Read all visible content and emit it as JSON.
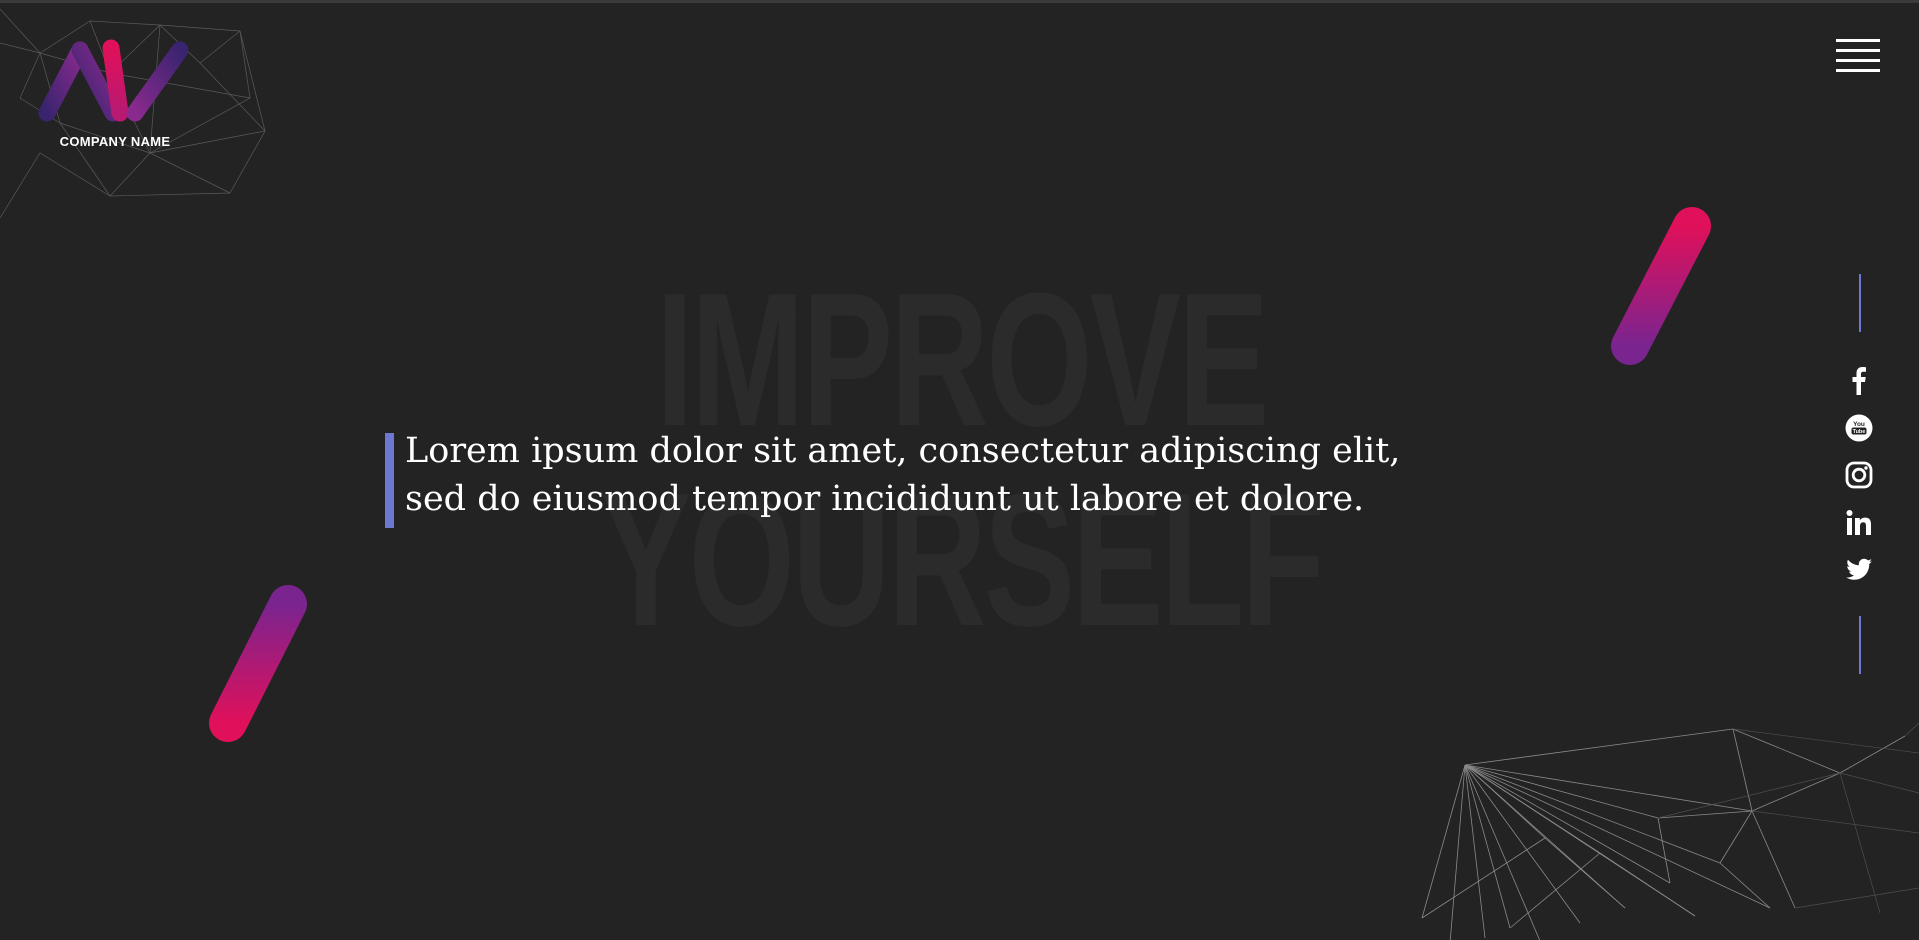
{
  "header": {
    "company_name": "COMPANY NAME",
    "logo_icon": "zigzag-logo-icon",
    "menu_icon": "hamburger-menu-icon"
  },
  "hero": {
    "background_word_line1": "IMPROVE",
    "background_word_line2": "YOURSELF",
    "quote": "Lorem ipsum dolor sit amet, consectetur adipiscing elit, sed do eiusmod tempor incididunt ut labore et dolore."
  },
  "social": {
    "items": [
      {
        "icon": "facebook-icon"
      },
      {
        "icon": "youtube-icon"
      },
      {
        "icon": "instagram-icon"
      },
      {
        "icon": "linkedin-icon"
      },
      {
        "icon": "twitter-icon"
      }
    ]
  },
  "colors": {
    "background": "#232323",
    "accent": "#6d78d2",
    "gradient_pink": "#e0105a",
    "gradient_purple": "#2e1f63",
    "text": "#ffffff",
    "watermark": "#2b2b2b"
  }
}
